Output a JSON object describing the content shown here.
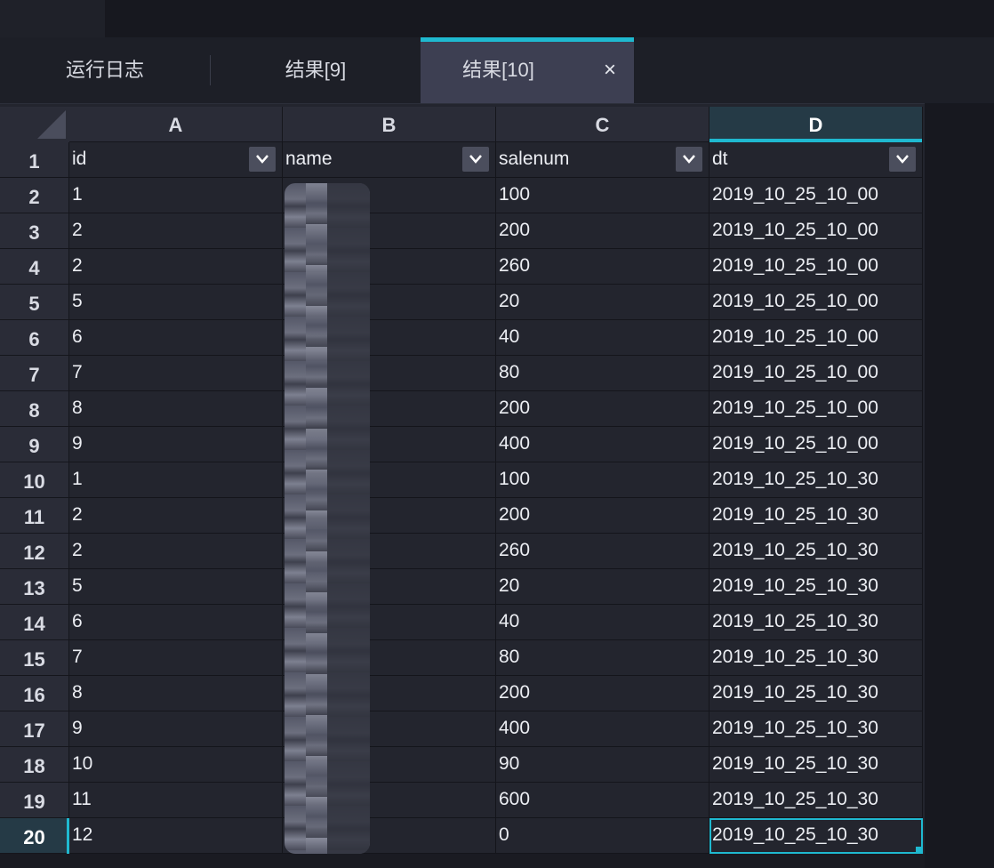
{
  "tabs": [
    {
      "label": "运行日志"
    },
    {
      "label": "结果[9]"
    },
    {
      "label": "结果[10]",
      "close": "×"
    }
  ],
  "columns": [
    "A",
    "B",
    "C",
    "D"
  ],
  "header_row": {
    "row_label": "1",
    "fields": [
      "id",
      "name",
      "salenum",
      "dt"
    ]
  },
  "rows": [
    {
      "row": "2",
      "id": "1",
      "name": "",
      "salenum": "100",
      "dt": "2019_10_25_10_00"
    },
    {
      "row": "3",
      "id": "2",
      "name": "",
      "salenum": "200",
      "dt": "2019_10_25_10_00"
    },
    {
      "row": "4",
      "id": "2",
      "name": "",
      "salenum": "260",
      "dt": "2019_10_25_10_00"
    },
    {
      "row": "5",
      "id": "5",
      "name": "",
      "salenum": "20",
      "dt": "2019_10_25_10_00"
    },
    {
      "row": "6",
      "id": "6",
      "name": "",
      "salenum": "40",
      "dt": "2019_10_25_10_00"
    },
    {
      "row": "7",
      "id": "7",
      "name": "",
      "salenum": "80",
      "dt": "2019_10_25_10_00"
    },
    {
      "row": "8",
      "id": "8",
      "name": "",
      "salenum": "200",
      "dt": "2019_10_25_10_00"
    },
    {
      "row": "9",
      "id": "9",
      "name": "",
      "salenum": "400",
      "dt": "2019_10_25_10_00"
    },
    {
      "row": "10",
      "id": "1",
      "name": "",
      "salenum": "100",
      "dt": "2019_10_25_10_30"
    },
    {
      "row": "11",
      "id": "2",
      "name": "",
      "salenum": "200",
      "dt": "2019_10_25_10_30"
    },
    {
      "row": "12",
      "id": "2",
      "name": "",
      "salenum": "260",
      "dt": "2019_10_25_10_30"
    },
    {
      "row": "13",
      "id": "5",
      "name": "",
      "salenum": "20",
      "dt": "2019_10_25_10_30"
    },
    {
      "row": "14",
      "id": "6",
      "name": "",
      "salenum": "40",
      "dt": "2019_10_25_10_30"
    },
    {
      "row": "15",
      "id": "7",
      "name": "",
      "salenum": "80",
      "dt": "2019_10_25_10_30"
    },
    {
      "row": "16",
      "id": "8",
      "name": "",
      "salenum": "200",
      "dt": "2019_10_25_10_30"
    },
    {
      "row": "17",
      "id": "9",
      "name": "",
      "salenum": "400",
      "dt": "2019_10_25_10_30"
    },
    {
      "row": "18",
      "id": "10",
      "name": "",
      "salenum": "90",
      "dt": "2019_10_25_10_30"
    },
    {
      "row": "19",
      "id": "11",
      "name": "",
      "salenum": "600",
      "dt": "2019_10_25_10_30"
    },
    {
      "row": "20",
      "id": "12",
      "name": "",
      "salenum": "0",
      "dt": "2019_10_25_10_30"
    }
  ],
  "selection": {
    "active_column": "D",
    "active_row": "20"
  },
  "icons": {
    "filter": "chevron-down-icon",
    "close": "close-icon"
  },
  "colors": {
    "accent": "#1fb9d0",
    "background": "#23252e",
    "header": "#2a2c37"
  }
}
